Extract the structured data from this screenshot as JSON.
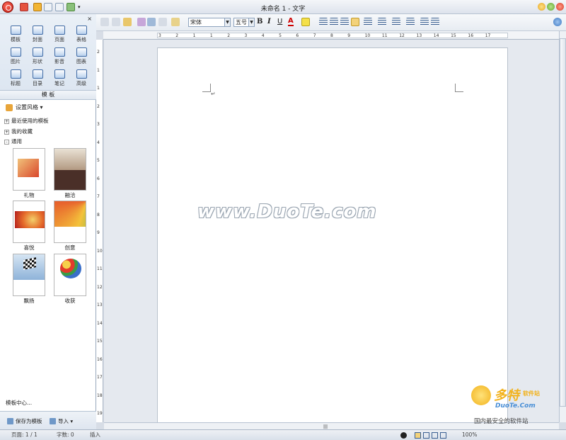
{
  "window": {
    "title": "未命名 1 - 文字"
  },
  "toolbar": {
    "font_name": "宋体",
    "font_size": "五号",
    "bold": "B",
    "italic": "I",
    "underline": "U",
    "font_color": "A"
  },
  "panel": {
    "icons": [
      {
        "label": "模板",
        "icon": "template-icon"
      },
      {
        "label": "封面",
        "icon": "cover-icon"
      },
      {
        "label": "页面",
        "icon": "page-icon"
      },
      {
        "label": "表格",
        "icon": "table-icon"
      },
      {
        "label": "图片",
        "icon": "picture-icon"
      },
      {
        "label": "形状",
        "icon": "shape-icon"
      },
      {
        "label": "影音",
        "icon": "media-icon"
      },
      {
        "label": "图表",
        "icon": "chart-icon"
      },
      {
        "label": "标题",
        "icon": "heading-icon"
      },
      {
        "label": "目录",
        "icon": "toc-icon"
      },
      {
        "label": "笔记",
        "icon": "note-icon"
      },
      {
        "label": "高级",
        "icon": "advanced-icon"
      }
    ],
    "section_title": "模 板",
    "style_button": "设置风格",
    "tree": [
      {
        "toggle": "+",
        "label": "最近使用的模板"
      },
      {
        "toggle": "+",
        "label": "我的收藏"
      },
      {
        "toggle": "-",
        "label": "通用"
      }
    ],
    "templates": [
      {
        "label": "礼物"
      },
      {
        "label": "融洽"
      },
      {
        "label": "喜悦"
      },
      {
        "label": "创意"
      },
      {
        "label": "飘扬"
      },
      {
        "label": "收获"
      }
    ],
    "template_center": "模板中心...",
    "save_as_template": "保存为模板",
    "import": "导入"
  },
  "ruler": {
    "h_ticks": [
      "3",
      "2",
      "1",
      "1",
      "2",
      "3",
      "4",
      "5",
      "6",
      "7",
      "8",
      "9",
      "10",
      "11",
      "12",
      "13",
      "14",
      "15",
      "16",
      "17"
    ],
    "v_ticks": [
      "2",
      "1",
      "1",
      "2",
      "3",
      "4",
      "5",
      "6",
      "7",
      "8",
      "9",
      "10",
      "11",
      "12",
      "13",
      "14",
      "15",
      "16",
      "17",
      "18",
      "19"
    ]
  },
  "document": {
    "watermark": "www.DuoTe.com"
  },
  "status": {
    "page": "页面: 1 / 1",
    "words": "字数: 0",
    "mode": "插入",
    "zoom": "100%"
  },
  "brand": {
    "name": "多特",
    "sub": "软件站",
    "url": "DuoTe.Com",
    "slogan": "国内最安全的软件站"
  }
}
